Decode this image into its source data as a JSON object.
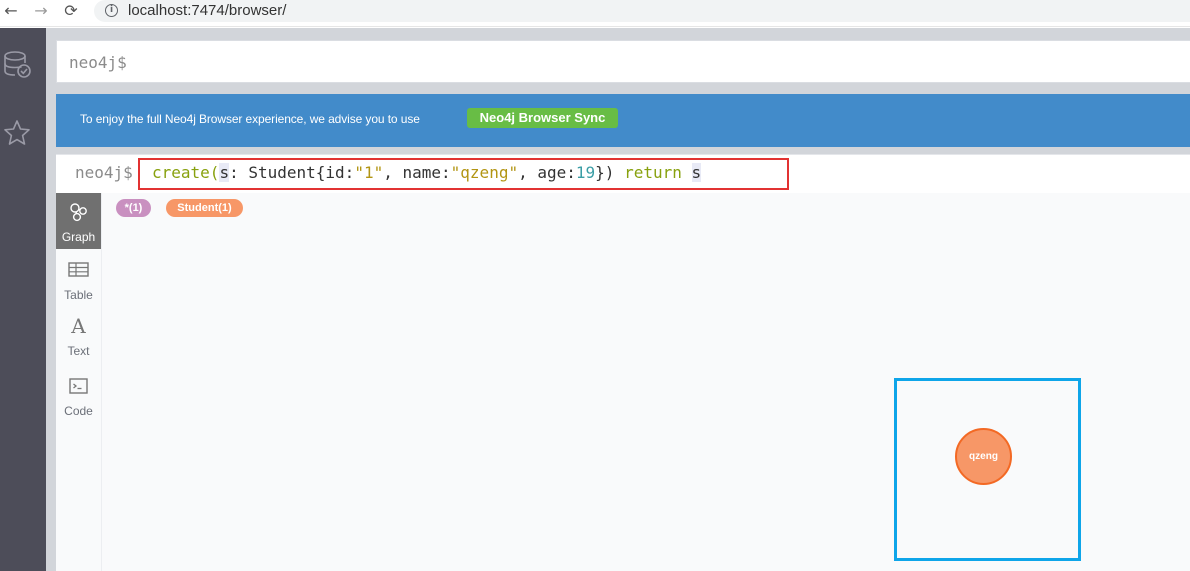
{
  "browser": {
    "url": "localhost:7474/browser/",
    "back_icon": "←",
    "forward_icon": "→",
    "reload_icon": "⟳",
    "info_icon": "i"
  },
  "sidebar": {
    "items": [
      {
        "name": "database",
        "icon": "database-check-icon"
      },
      {
        "name": "favorites",
        "icon": "star-icon"
      }
    ],
    "background": "#4d4d59"
  },
  "editor": {
    "prompt": "neo4j$"
  },
  "banner": {
    "text": "To enjoy the full Neo4j Browser experience, we advise you to use",
    "button_label": "Neo4j Browser Sync",
    "background": "#428bca",
    "button_color": "#68bd45"
  },
  "frame": {
    "prompt": "neo4j$",
    "query": {
      "t1": "create(",
      "t2": "s",
      "t3": ": Student{id:",
      "t4": "\"1\"",
      "t5": ", name:",
      "t6": "\"qzeng\"",
      "t7": ", age:",
      "t8": "19",
      "t9": "}) ",
      "t10": "return",
      "t11": " ",
      "t12": "s"
    },
    "highlight_color": "#e23232",
    "view_tabs": [
      {
        "label": "Graph",
        "icon": "graph-icon",
        "active": true
      },
      {
        "label": "Table",
        "icon": "table-icon",
        "active": false
      },
      {
        "label": "Text",
        "icon": "text-icon",
        "active": false
      },
      {
        "label": "Code",
        "icon": "code-icon",
        "active": false
      }
    ],
    "pills": {
      "all": "*(1)",
      "student": "Student(1)"
    },
    "node": {
      "label": "qzeng",
      "color": "#f79767",
      "border_color": "#f36924"
    },
    "selection_color": "#0ea5e9"
  }
}
